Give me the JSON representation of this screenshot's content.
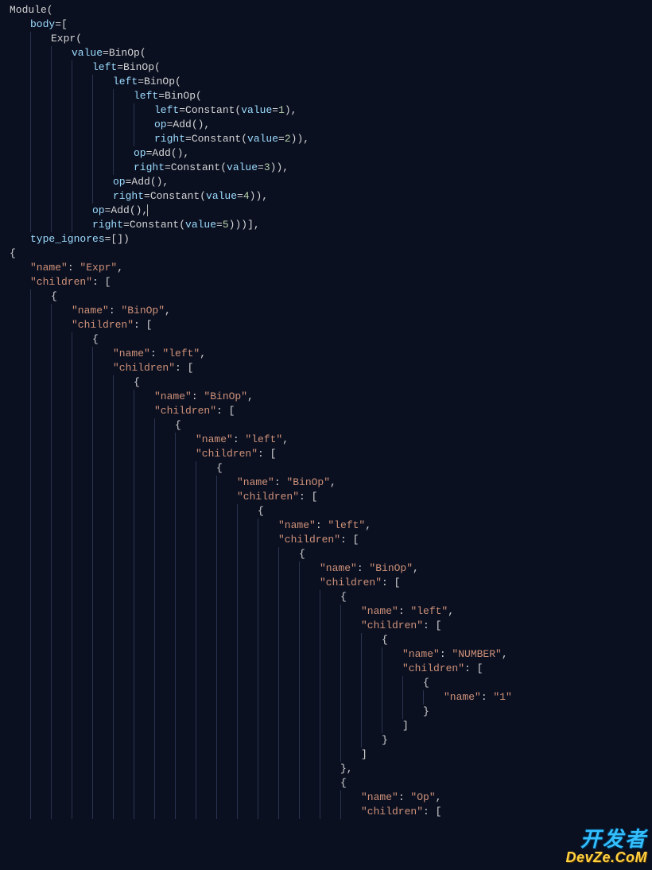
{
  "watermark": {
    "cn": "开发者",
    "en": "DevZe.CoM"
  },
  "lines": [
    {
      "guides": 0,
      "segs": [
        [
          "p",
          "Module("
        ]
      ]
    },
    {
      "guides": 1,
      "segs": [
        [
          "v",
          "body"
        ],
        [
          "p",
          "=["
        ]
      ]
    },
    {
      "guides": 2,
      "segs": [
        [
          "p",
          "Expr("
        ]
      ]
    },
    {
      "guides": 3,
      "segs": [
        [
          "v",
          "value"
        ],
        [
          "p",
          "=BinOp("
        ]
      ]
    },
    {
      "guides": 4,
      "segs": [
        [
          "v",
          "left"
        ],
        [
          "p",
          "=BinOp("
        ]
      ]
    },
    {
      "guides": 5,
      "segs": [
        [
          "v",
          "left"
        ],
        [
          "p",
          "=BinOp("
        ]
      ]
    },
    {
      "guides": 6,
      "segs": [
        [
          "v",
          "left"
        ],
        [
          "p",
          "=BinOp("
        ]
      ]
    },
    {
      "guides": 7,
      "segs": [
        [
          "v",
          "left"
        ],
        [
          "p",
          "=Constant("
        ],
        [
          "v",
          "value"
        ],
        [
          "p",
          "="
        ],
        [
          "n",
          "1"
        ],
        [
          "p",
          "),"
        ]
      ]
    },
    {
      "guides": 7,
      "segs": [
        [
          "v",
          "op"
        ],
        [
          "p",
          "=Add(),"
        ]
      ]
    },
    {
      "guides": 7,
      "segs": [
        [
          "v",
          "right"
        ],
        [
          "p",
          "=Constant("
        ],
        [
          "v",
          "value"
        ],
        [
          "p",
          "="
        ],
        [
          "n",
          "2"
        ],
        [
          "p",
          ")),"
        ]
      ]
    },
    {
      "guides": 6,
      "segs": [
        [
          "v",
          "op"
        ],
        [
          "p",
          "=Add(),"
        ]
      ]
    },
    {
      "guides": 6,
      "segs": [
        [
          "v",
          "right"
        ],
        [
          "p",
          "=Constant("
        ],
        [
          "v",
          "value"
        ],
        [
          "p",
          "="
        ],
        [
          "n",
          "3"
        ],
        [
          "p",
          ")),"
        ]
      ]
    },
    {
      "guides": 5,
      "segs": [
        [
          "v",
          "op"
        ],
        [
          "p",
          "=Add(),"
        ]
      ]
    },
    {
      "guides": 5,
      "segs": [
        [
          "v",
          "right"
        ],
        [
          "p",
          "=Constant("
        ],
        [
          "v",
          "value"
        ],
        [
          "p",
          "="
        ],
        [
          "n",
          "4"
        ],
        [
          "p",
          ")),"
        ]
      ]
    },
    {
      "guides": 4,
      "segs": [
        [
          "v",
          "op"
        ],
        [
          "p",
          "=Add(),"
        ]
      ],
      "cursor": true
    },
    {
      "guides": 4,
      "segs": [
        [
          "v",
          "right"
        ],
        [
          "p",
          "=Constant("
        ],
        [
          "v",
          "value"
        ],
        [
          "p",
          "="
        ],
        [
          "n",
          "5"
        ],
        [
          "p",
          ")))],"
        ]
      ]
    },
    {
      "guides": 1,
      "segs": [
        [
          "v",
          "type_ignores"
        ],
        [
          "p",
          "=[])"
        ]
      ]
    },
    {
      "guides": 0,
      "segs": [
        [
          "w",
          "{"
        ]
      ]
    },
    {
      "guides": 1,
      "segs": [
        [
          "s",
          "\"name\""
        ],
        [
          "w",
          ": "
        ],
        [
          "s",
          "\"Expr\""
        ],
        [
          "w",
          ","
        ]
      ]
    },
    {
      "guides": 1,
      "segs": [
        [
          "s",
          "\"children\""
        ],
        [
          "w",
          ": ["
        ]
      ]
    },
    {
      "guides": 2,
      "segs": [
        [
          "w",
          "{"
        ]
      ]
    },
    {
      "guides": 3,
      "segs": [
        [
          "s",
          "\"name\""
        ],
        [
          "w",
          ": "
        ],
        [
          "s",
          "\"BinOp\""
        ],
        [
          "w",
          ","
        ]
      ]
    },
    {
      "guides": 3,
      "segs": [
        [
          "s",
          "\"children\""
        ],
        [
          "w",
          ": ["
        ]
      ]
    },
    {
      "guides": 4,
      "segs": [
        [
          "w",
          "{"
        ]
      ]
    },
    {
      "guides": 5,
      "segs": [
        [
          "s",
          "\"name\""
        ],
        [
          "w",
          ": "
        ],
        [
          "s",
          "\"left\""
        ],
        [
          "w",
          ","
        ]
      ]
    },
    {
      "guides": 5,
      "segs": [
        [
          "s",
          "\"children\""
        ],
        [
          "w",
          ": ["
        ]
      ]
    },
    {
      "guides": 6,
      "segs": [
        [
          "w",
          "{"
        ]
      ]
    },
    {
      "guides": 7,
      "segs": [
        [
          "s",
          "\"name\""
        ],
        [
          "w",
          ": "
        ],
        [
          "s",
          "\"BinOp\""
        ],
        [
          "w",
          ","
        ]
      ]
    },
    {
      "guides": 7,
      "segs": [
        [
          "s",
          "\"children\""
        ],
        [
          "w",
          ": ["
        ]
      ]
    },
    {
      "guides": 8,
      "segs": [
        [
          "w",
          "{"
        ]
      ]
    },
    {
      "guides": 9,
      "segs": [
        [
          "s",
          "\"name\""
        ],
        [
          "w",
          ": "
        ],
        [
          "s",
          "\"left\""
        ],
        [
          "w",
          ","
        ]
      ]
    },
    {
      "guides": 9,
      "segs": [
        [
          "s",
          "\"children\""
        ],
        [
          "w",
          ": ["
        ]
      ]
    },
    {
      "guides": 10,
      "segs": [
        [
          "w",
          "{"
        ]
      ]
    },
    {
      "guides": 11,
      "segs": [
        [
          "s",
          "\"name\""
        ],
        [
          "w",
          ": "
        ],
        [
          "s",
          "\"BinOp\""
        ],
        [
          "w",
          ","
        ]
      ]
    },
    {
      "guides": 11,
      "segs": [
        [
          "s",
          "\"children\""
        ],
        [
          "w",
          ": ["
        ]
      ]
    },
    {
      "guides": 12,
      "segs": [
        [
          "w",
          "{"
        ]
      ]
    },
    {
      "guides": 13,
      "segs": [
        [
          "s",
          "\"name\""
        ],
        [
          "w",
          ": "
        ],
        [
          "s",
          "\"left\""
        ],
        [
          "w",
          ","
        ]
      ]
    },
    {
      "guides": 13,
      "segs": [
        [
          "s",
          "\"children\""
        ],
        [
          "w",
          ": ["
        ]
      ]
    },
    {
      "guides": 14,
      "segs": [
        [
          "w",
          "{"
        ]
      ]
    },
    {
      "guides": 15,
      "segs": [
        [
          "s",
          "\"name\""
        ],
        [
          "w",
          ": "
        ],
        [
          "s",
          "\"BinOp\""
        ],
        [
          "w",
          ","
        ]
      ]
    },
    {
      "guides": 15,
      "segs": [
        [
          "s",
          "\"children\""
        ],
        [
          "w",
          ": ["
        ]
      ]
    },
    {
      "guides": 16,
      "segs": [
        [
          "w",
          "{"
        ]
      ]
    },
    {
      "guides": 17,
      "segs": [
        [
          "s",
          "\"name\""
        ],
        [
          "w",
          ": "
        ],
        [
          "s",
          "\"left\""
        ],
        [
          "w",
          ","
        ]
      ]
    },
    {
      "guides": 17,
      "segs": [
        [
          "s",
          "\"children\""
        ],
        [
          "w",
          ": ["
        ]
      ]
    },
    {
      "guides": 18,
      "segs": [
        [
          "w",
          "{"
        ]
      ]
    },
    {
      "guides": 19,
      "segs": [
        [
          "s",
          "\"name\""
        ],
        [
          "w",
          ": "
        ],
        [
          "s",
          "\"NUMBER\""
        ],
        [
          "w",
          ","
        ]
      ]
    },
    {
      "guides": 19,
      "segs": [
        [
          "s",
          "\"children\""
        ],
        [
          "w",
          ": ["
        ]
      ]
    },
    {
      "guides": 20,
      "segs": [
        [
          "w",
          "{"
        ]
      ]
    },
    {
      "guides": 21,
      "segs": [
        [
          "s",
          "\"name\""
        ],
        [
          "w",
          ": "
        ],
        [
          "s",
          "\"1\""
        ]
      ]
    },
    {
      "guides": 20,
      "segs": [
        [
          "w",
          "}"
        ]
      ]
    },
    {
      "guides": 19,
      "segs": [
        [
          "w",
          "]"
        ]
      ]
    },
    {
      "guides": 18,
      "segs": [
        [
          "w",
          "}"
        ]
      ]
    },
    {
      "guides": 17,
      "segs": [
        [
          "w",
          "]"
        ]
      ]
    },
    {
      "guides": 16,
      "segs": [
        [
          "w",
          "},"
        ]
      ]
    },
    {
      "guides": 16,
      "segs": [
        [
          "w",
          "{"
        ]
      ]
    },
    {
      "guides": 17,
      "segs": [
        [
          "s",
          "\"name\""
        ],
        [
          "w",
          ": "
        ],
        [
          "s",
          "\"Op\""
        ],
        [
          "w",
          ","
        ]
      ]
    },
    {
      "guides": 17,
      "segs": [
        [
          "s",
          "\"children\""
        ],
        [
          "w",
          ": ["
        ]
      ]
    }
  ]
}
